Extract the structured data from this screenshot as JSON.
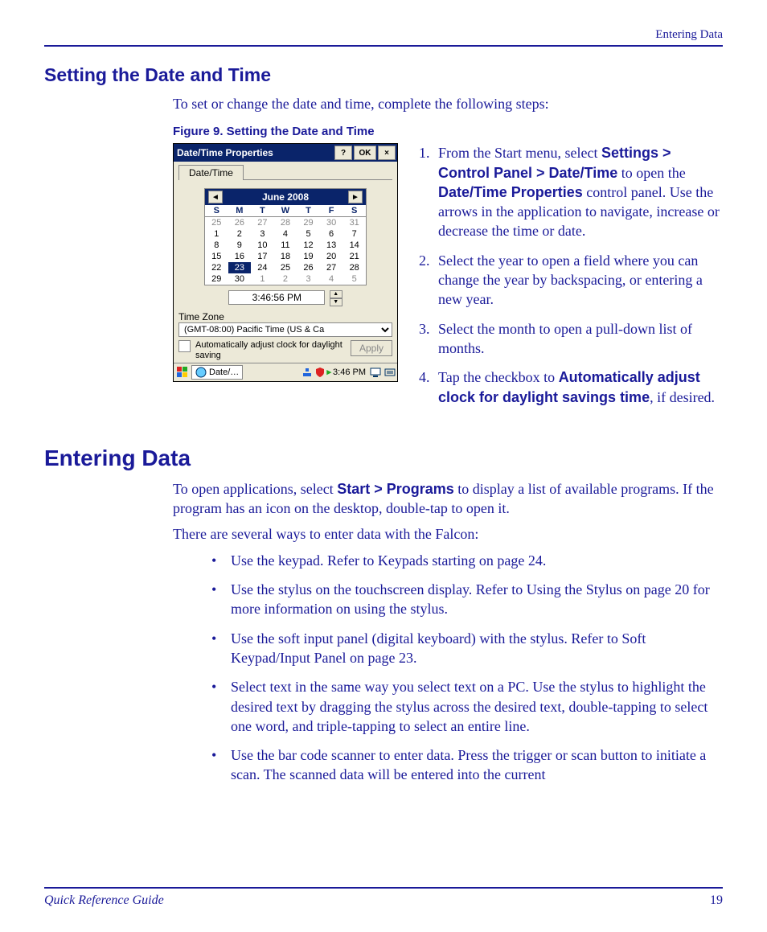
{
  "header": {
    "section": "Entering Data"
  },
  "heading_setting": "Setting the Date and Time",
  "intro_setting": "To set or change the date and time, complete the following steps:",
  "figure_caption": "Figure 9. Setting the Date and Time",
  "device": {
    "window_title": "Date/Time Properties",
    "btn_help": "?",
    "btn_ok": "OK",
    "btn_close": "×",
    "tab_label": "Date/Time",
    "cal_prev": "◄",
    "cal_next": "►",
    "cal_month": "June 2008",
    "dow": [
      "S",
      "M",
      "T",
      "W",
      "T",
      "F",
      "S"
    ],
    "weeks": [
      [
        {
          "d": "25",
          "dim": true
        },
        {
          "d": "26",
          "dim": true
        },
        {
          "d": "27",
          "dim": true
        },
        {
          "d": "28",
          "dim": true
        },
        {
          "d": "29",
          "dim": true
        },
        {
          "d": "30",
          "dim": true
        },
        {
          "d": "31",
          "dim": true
        }
      ],
      [
        {
          "d": "1"
        },
        {
          "d": "2"
        },
        {
          "d": "3"
        },
        {
          "d": "4"
        },
        {
          "d": "5"
        },
        {
          "d": "6"
        },
        {
          "d": "7"
        }
      ],
      [
        {
          "d": "8"
        },
        {
          "d": "9"
        },
        {
          "d": "10"
        },
        {
          "d": "11"
        },
        {
          "d": "12"
        },
        {
          "d": "13"
        },
        {
          "d": "14"
        }
      ],
      [
        {
          "d": "15"
        },
        {
          "d": "16"
        },
        {
          "d": "17"
        },
        {
          "d": "18"
        },
        {
          "d": "19"
        },
        {
          "d": "20"
        },
        {
          "d": "21"
        }
      ],
      [
        {
          "d": "22"
        },
        {
          "d": "23",
          "today": true
        },
        {
          "d": "24"
        },
        {
          "d": "25"
        },
        {
          "d": "26"
        },
        {
          "d": "27"
        },
        {
          "d": "28"
        }
      ],
      [
        {
          "d": "29"
        },
        {
          "d": "30"
        },
        {
          "d": "1",
          "dim": true
        },
        {
          "d": "2",
          "dim": true
        },
        {
          "d": "3",
          "dim": true
        },
        {
          "d": "4",
          "dim": true
        },
        {
          "d": "5",
          "dim": true
        }
      ]
    ],
    "time_value": "3:46:56 PM",
    "tz_label": "Time Zone",
    "tz_value": "(GMT-08:00) Pacific Time (US & Ca",
    "auto_adjust": "Automatically adjust clock for daylight saving",
    "apply": "Apply",
    "taskbar_app": "Date/…",
    "taskbar_time": "3:46 PM"
  },
  "steps": {
    "s1a": "From the Start menu, select ",
    "s1b": "Settings > Control Panel > Date/Time",
    "s1c": " to open the ",
    "s1d": "Date/Time Properties",
    "s1e": " control panel. Use the arrows in the application to navigate, increase or decrease the time or date.",
    "s2": "Select the year to open a field where you can change the year by backspacing, or entering a new year.",
    "s3": "Select the month to open a pull-down list of months.",
    "s4a": "Tap the checkbox to ",
    "s4b": "Automatically adjust clock for daylight savings time",
    "s4c": ", if desired."
  },
  "heading_entering": "Entering Data",
  "enter_p1a": "To open applications, select ",
  "enter_p1b": "Start > Programs",
  "enter_p1c": " to display a list of available programs. If the program has an icon on the desktop, double-tap to open it.",
  "enter_p2": "There are several ways to enter data with the Falcon:",
  "bullets": {
    "b1a": "Use the keypad. Refer to Keypads starting on page ",
    "b1b": "24",
    "b1c": ".",
    "b2a": "Use the stylus on the touchscreen display. Refer to Using the Stylus on page ",
    "b2b": "20",
    "b2c": " for more information on using the stylus.",
    "b3a": "Use the soft input panel (digital keyboard) with the stylus. Refer to Soft Keypad/Input Panel on page ",
    "b3b": "23",
    "b3c": ".",
    "b4": "Select text in the same way you select text on a PC. Use the stylus to highlight the desired text by dragging the stylus across the desired text, double-tapping to select one word, and triple-tapping to select an entire line.",
    "b5": "Use the bar code scanner to enter data. Press the trigger or scan button to initiate a scan. The scanned data will be entered into the current"
  },
  "footer": {
    "guide": "Quick Reference Guide",
    "page": "19"
  }
}
